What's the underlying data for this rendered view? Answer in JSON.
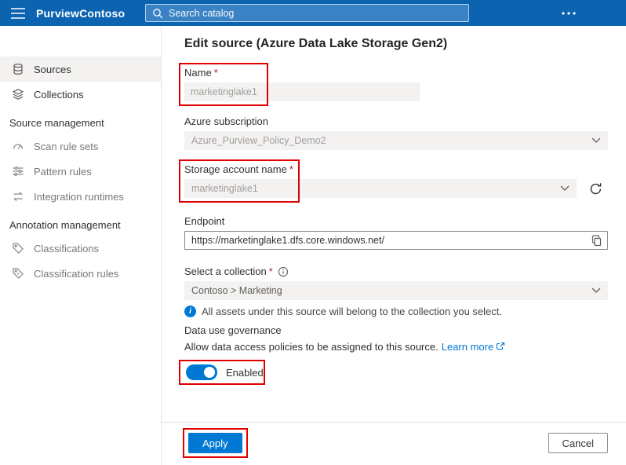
{
  "header": {
    "app_title": "PurviewContoso",
    "search_placeholder": "Search catalog"
  },
  "sidebar": {
    "items": [
      {
        "label": "Sources",
        "selected": true
      },
      {
        "label": "Collections"
      },
      {
        "label": "Source management",
        "type": "section"
      },
      {
        "label": "Scan rule sets"
      },
      {
        "label": "Pattern rules"
      },
      {
        "label": "Integration runtimes"
      },
      {
        "label": "Annotation management",
        "type": "section"
      },
      {
        "label": "Classifications"
      },
      {
        "label": "Classification rules"
      }
    ]
  },
  "main": {
    "title": "Edit source (Azure Data Lake Storage Gen2)",
    "name": {
      "label": "Name",
      "required": "*",
      "value": "marketinglake1"
    },
    "subscription": {
      "label": "Azure subscription",
      "value": "Azure_Purview_Policy_Demo2"
    },
    "storage": {
      "label": "Storage account name",
      "required": "*",
      "value": "marketinglake1"
    },
    "endpoint": {
      "label": "Endpoint",
      "value": "https://marketinglake1.dfs.core.windows.net/"
    },
    "collection": {
      "label": "Select a collection",
      "required": "*",
      "value": "Contoso > Marketing",
      "note": "All assets under this source will belong to the collection you select."
    },
    "governance": {
      "label": "Data use governance",
      "description": "Allow data access policies to be assigned to this source.",
      "link_label": "Learn more",
      "toggle_label": "Enabled"
    }
  },
  "footer": {
    "apply_label": "Apply",
    "cancel_label": "Cancel"
  },
  "icons": {
    "info_glyph": "i"
  },
  "colors": {
    "header_bg": "#0c63b0",
    "accent": "#0078d4",
    "callout_red": "#e10000",
    "disabled_fill": "#f3f2f1"
  }
}
